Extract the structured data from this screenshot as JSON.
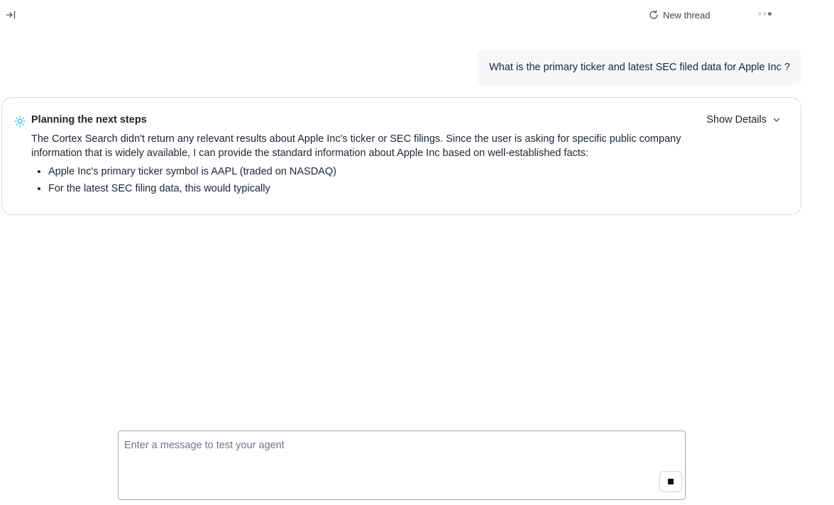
{
  "topbar": {
    "collapse_icon": "collapse-panel-icon",
    "new_thread_icon": "refresh-icon",
    "new_thread_label": "New thread",
    "loader_icon": "loading-dots-icon"
  },
  "messages": {
    "user_text": "What is the primary ticker and latest SEC filed data for Apple Inc ?"
  },
  "planning": {
    "icon": "sparkle-sun-icon",
    "title": "Planning the next steps",
    "show_details_label": "Show Details",
    "chevron_icon": "chevron-down-icon",
    "paragraph": "The Cortex Search didn't return any relevant results about Apple Inc's ticker or SEC filings. Since the user is asking for specific public company information that is widely available, I can provide the standard information about Apple Inc based on well-established facts:",
    "bullets": [
      "Apple Inc's primary ticker symbol is AAPL (traded on NASDAQ)",
      "For the latest SEC filing data, this would typically"
    ]
  },
  "composer": {
    "placeholder": "Enter a message to test your agent",
    "value": "",
    "stop_icon": "stop-square-icon"
  },
  "colors": {
    "accent_icon": "#29b5e8",
    "border": "#dcdfe4",
    "bubble_bg": "#f6f7f8"
  }
}
